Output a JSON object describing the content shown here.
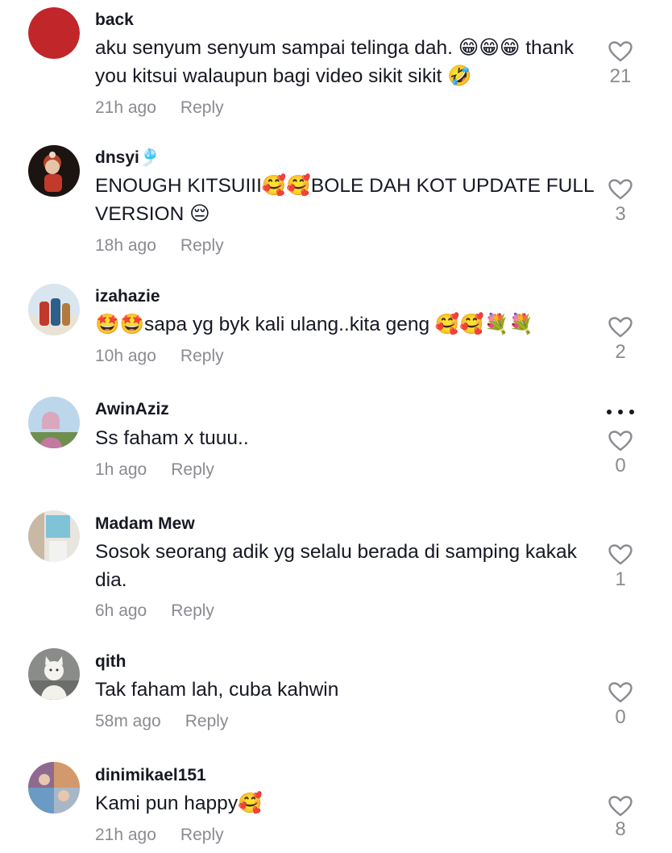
{
  "comments": [
    {
      "username": "back",
      "text": "aku senyum senyum sampai telinga dah. 😁😁😁 thank you kitsui walaupun bagi video sikit sikit 🤣",
      "time": "21h ago",
      "reply": "Reply",
      "likes": "21"
    },
    {
      "username": "dnsyi🎐",
      "text": "ENOUGH KITSUIII🥰🥰BOLE DAH KOT UPDATE FULL VERSION 😔",
      "time": "18h ago",
      "reply": "Reply",
      "likes": "3"
    },
    {
      "username": "izahazie",
      "text": "🤩🤩sapa yg byk kali ulang..kita geng 🥰🥰💐💐",
      "time": "10h ago",
      "reply": "Reply",
      "likes": "2"
    },
    {
      "username": "AwinAziz",
      "text": "Ss faham x tuuu..",
      "time": "1h ago",
      "reply": "Reply",
      "likes": "0"
    },
    {
      "username": "Madam Mew",
      "text": "Sosok seorang adik yg selalu berada di samping kakak dia.",
      "time": "6h ago",
      "reply": "Reply",
      "likes": "1"
    },
    {
      "username": "qith",
      "text": "Tak faham lah, cuba kahwin",
      "time": "58m ago",
      "reply": "Reply",
      "likes": "0"
    },
    {
      "username": "dinimikael151",
      "text": "Kami pun happy🥰",
      "time": "21h ago",
      "reply": "Reply",
      "likes": "8"
    }
  ],
  "icons": {
    "like": "heart-outline-icon",
    "more": "more-options-icon"
  },
  "colors": {
    "text_primary": "#161823",
    "text_secondary": "#8a8b91",
    "background": "#ffffff"
  }
}
